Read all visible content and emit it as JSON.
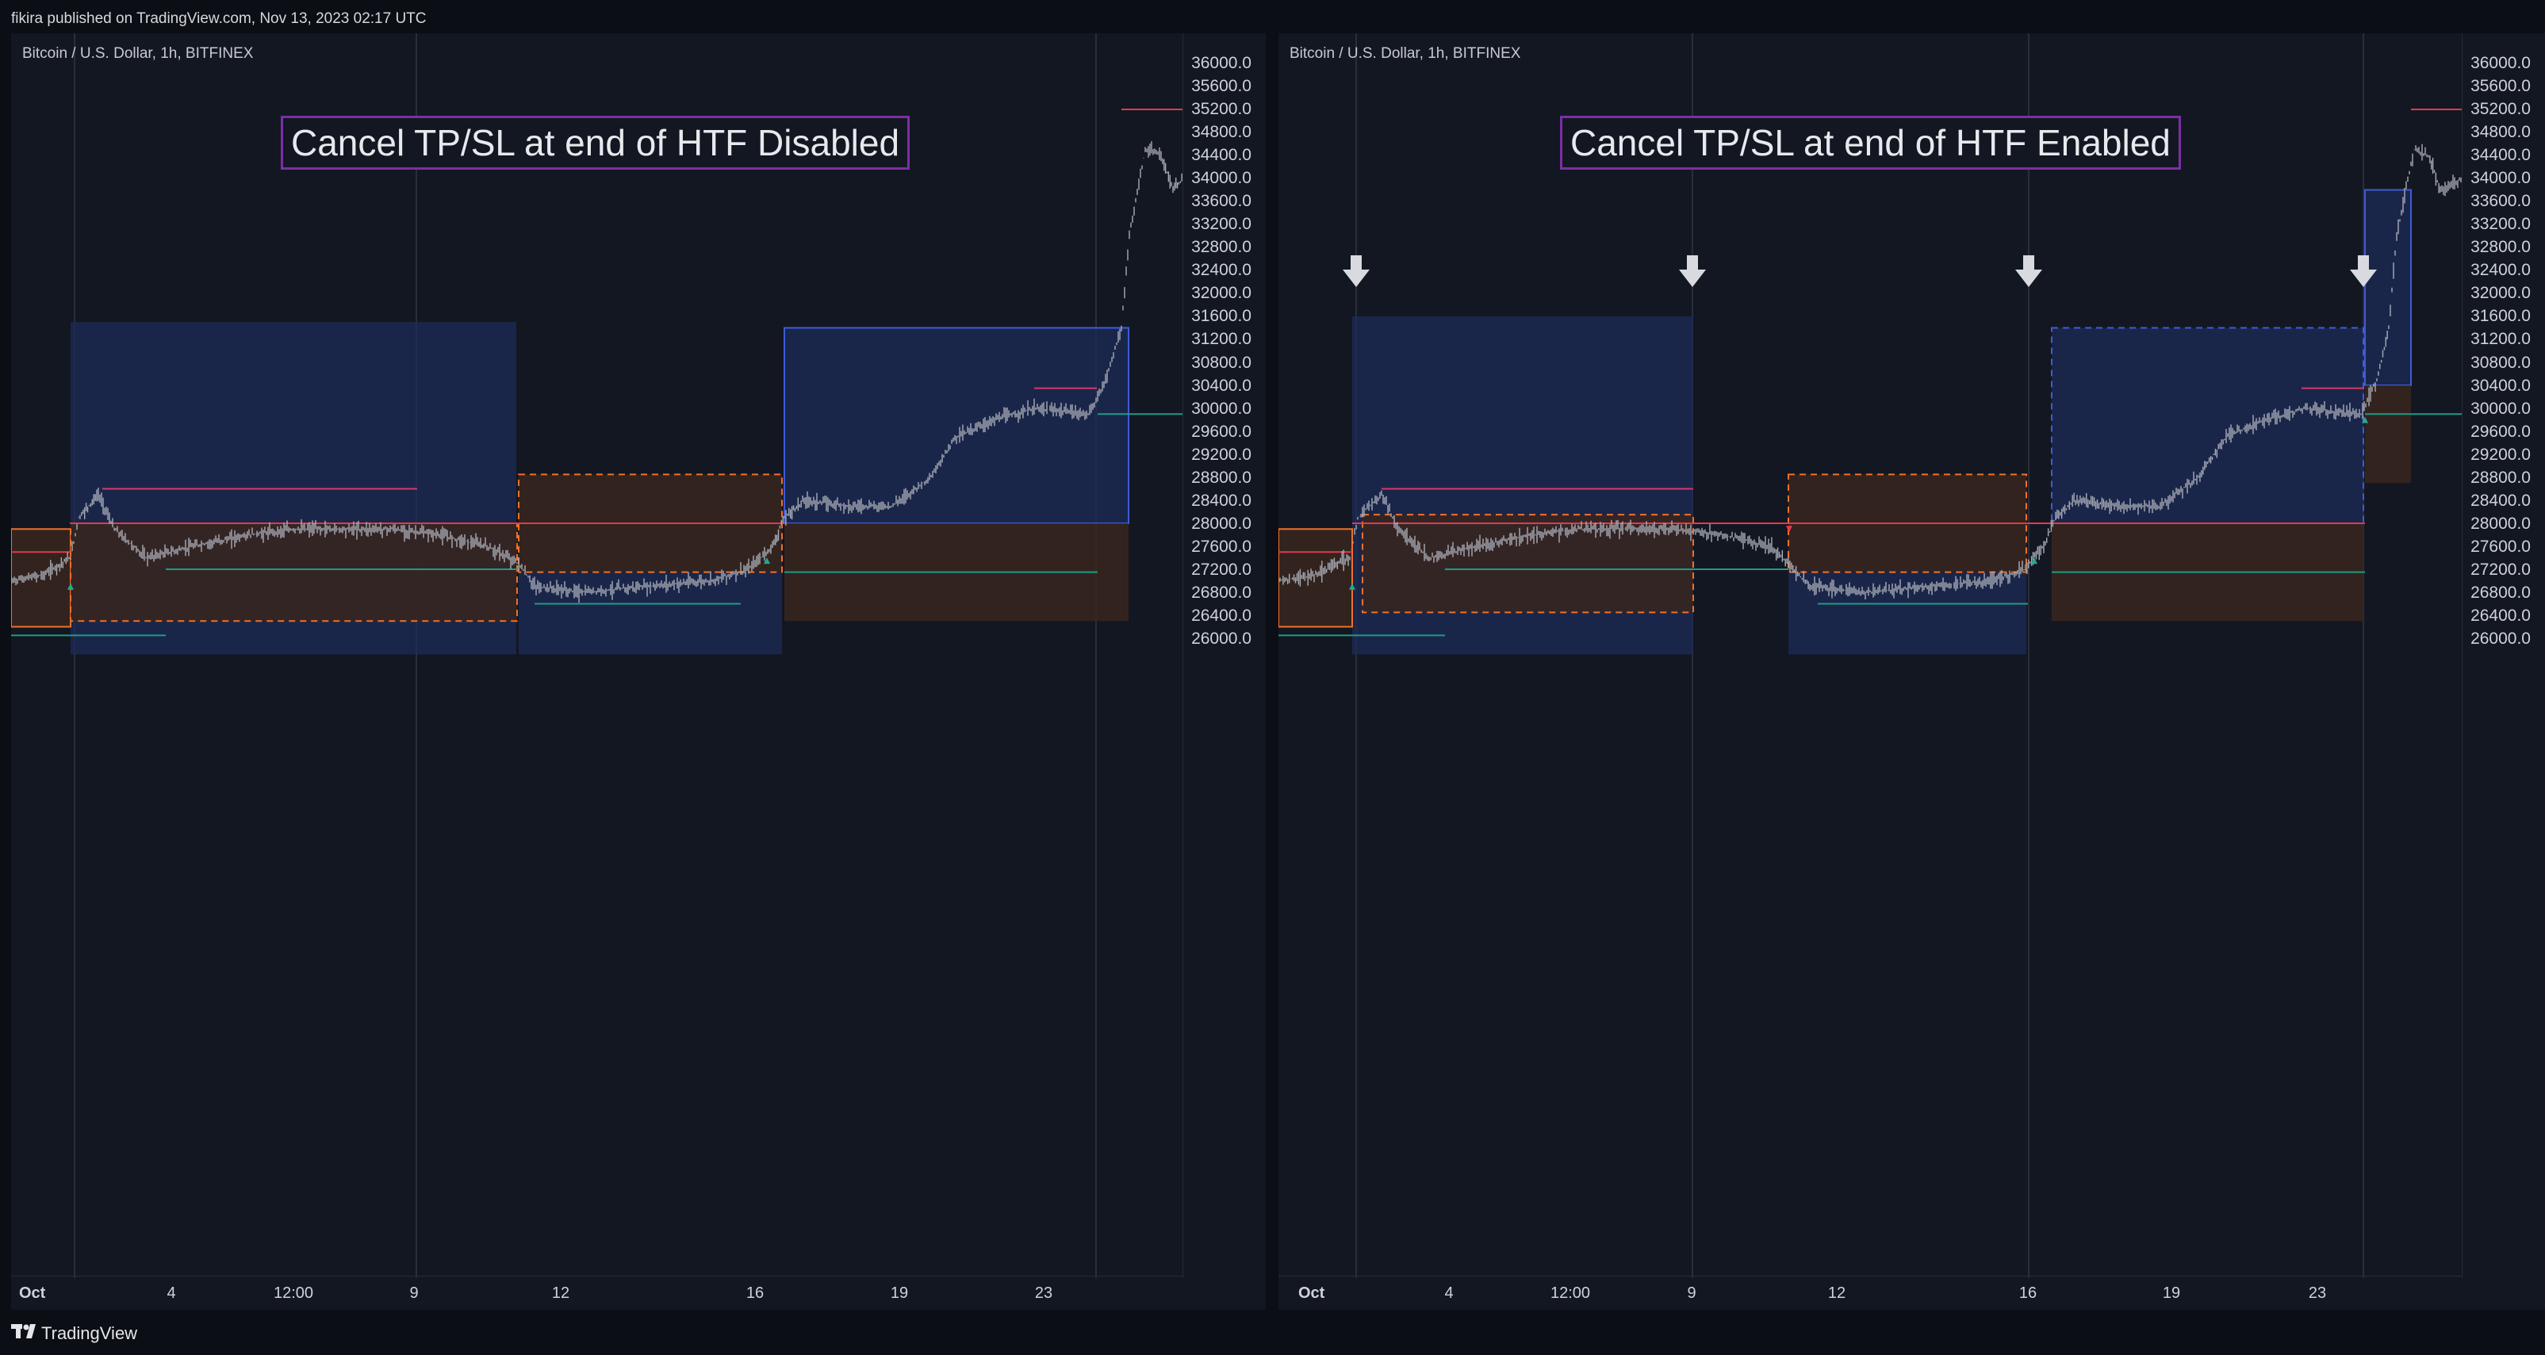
{
  "publish_note": "fikira published on TradingView.com, Nov 13, 2023 02:17 UTC",
  "footer_brand": "TradingView",
  "colors": {
    "bg": "#131722",
    "blue_box_fill": "#1d2c57",
    "blue_box_line": "#3d5bd9",
    "orange_box_fill": "#3a261e",
    "orange_box_line": "#f0702a",
    "red_line": "#e5394b",
    "teal_line": "#1f9b86",
    "magenta_line": "#d9376e",
    "candles": "#a9adb7",
    "banner_border": "#7b2fa5"
  },
  "panels": [
    {
      "title": "Bitcoin / U.S. Dollar, 1h, BITFINEX",
      "banner": "Cancel TP/SL at end of HTF Disabled",
      "price_ticks": [
        "36000.0",
        "35600.0",
        "35200.0",
        "34800.0",
        "34400.0",
        "34000.0",
        "33600.0",
        "33200.0",
        "32800.0",
        "32400.0",
        "32000.0",
        "31600.0",
        "31200.0",
        "30800.0",
        "30400.0",
        "30000.0",
        "29600.0",
        "29200.0",
        "28800.0",
        "28400.0",
        "28000.0",
        "27600.0",
        "27200.0",
        "26800.0",
        "26400.0",
        "26000.0"
      ],
      "time_ticks": [
        "Oct",
        "4",
        "12:00",
        "9",
        "12",
        "16",
        "19",
        "23"
      ],
      "arrows": []
    },
    {
      "title": "Bitcoin / U.S. Dollar, 1h, BITFINEX",
      "banner": "Cancel TP/SL at end of HTF Enabled",
      "price_ticks": [
        "36000.0",
        "35600.0",
        "35200.0",
        "34800.0",
        "34400.0",
        "34000.0",
        "33600.0",
        "33200.0",
        "32800.0",
        "32400.0",
        "32000.0",
        "31600.0",
        "31200.0",
        "30800.0",
        "30400.0",
        "30000.0",
        "29600.0",
        "29200.0",
        "28800.0",
        "28400.0",
        "28000.0",
        "27600.0",
        "27200.0",
        "26800.0",
        "26400.0",
        "26000.0"
      ],
      "time_ticks": [
        "Oct",
        "4",
        "12:00",
        "9",
        "12",
        "16",
        "19",
        "23"
      ],
      "arrows": [
        "down-arrow",
        "down-arrow",
        "down-arrow",
        "down-arrow"
      ]
    }
  ]
}
